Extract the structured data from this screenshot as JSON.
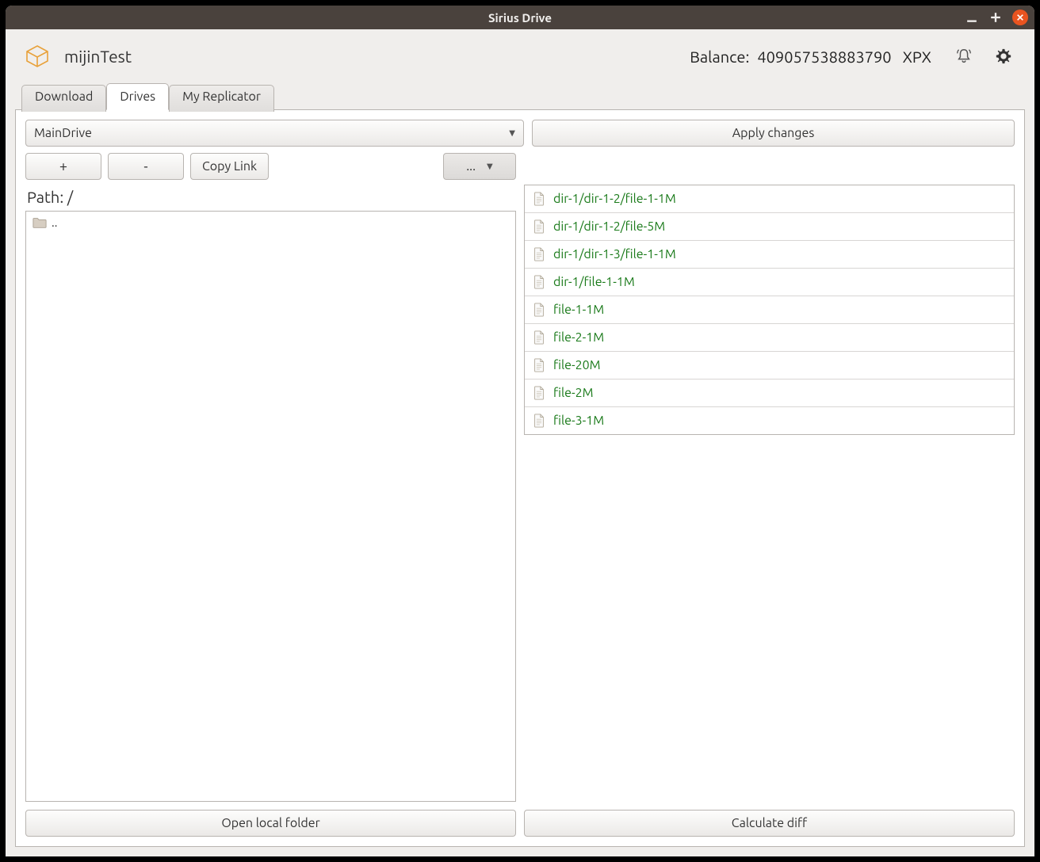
{
  "window": {
    "title": "Sirius Drive"
  },
  "header": {
    "account_name": "mijinTest",
    "balance_label": "Balance:",
    "balance_value": "409057538883790",
    "balance_currency": "XPX"
  },
  "tabs": [
    {
      "label": "Download",
      "active": false
    },
    {
      "label": "Drives",
      "active": true
    },
    {
      "label": "My Replicator",
      "active": false
    }
  ],
  "drive_select": {
    "selected": "MainDrive"
  },
  "buttons": {
    "apply": "Apply changes",
    "plus": "+",
    "minus": "-",
    "copy_link": "Copy Link",
    "more": "...",
    "open_local": "Open local folder",
    "calc_diff": "Calculate diff"
  },
  "path": {
    "label": "Path: /"
  },
  "browser": {
    "items": [
      {
        "name": "..",
        "type": "folder"
      }
    ]
  },
  "changes": [
    {
      "path": "dir-1/dir-1-2/file-1-1M"
    },
    {
      "path": "dir-1/dir-1-2/file-5M"
    },
    {
      "path": "dir-1/dir-1-3/file-1-1M"
    },
    {
      "path": "dir-1/file-1-1M"
    },
    {
      "path": "file-1-1M"
    },
    {
      "path": "file-2-1M"
    },
    {
      "path": "file-20M"
    },
    {
      "path": "file-2M"
    },
    {
      "path": "file-3-1M"
    }
  ]
}
